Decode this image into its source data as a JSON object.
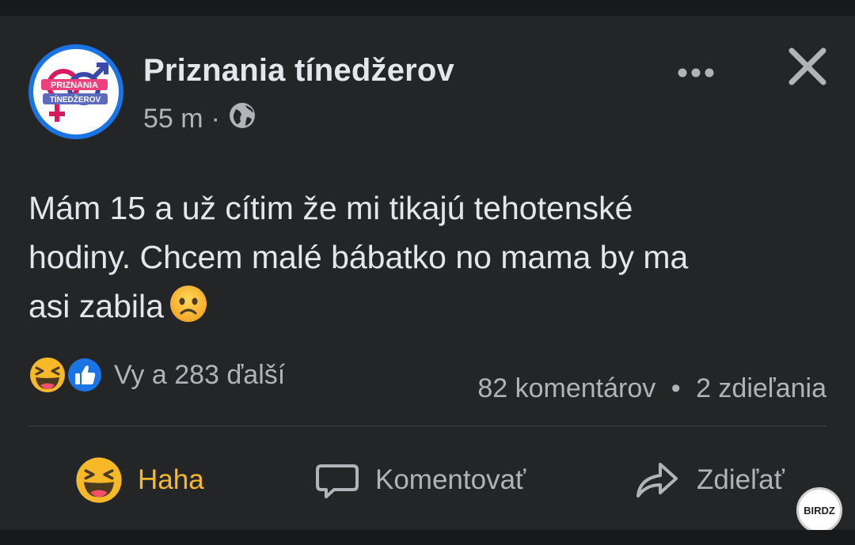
{
  "post": {
    "page_name": "Priznania tínedžerov",
    "time": "55 m",
    "separator": "·",
    "privacy_icon": "globe-icon",
    "avatar_text_top": "PRIZNANIA",
    "avatar_text_bottom": "TÍNEDŽEROV",
    "body_line1": "Mám 15 a už cítim že mi tikajú tehotenské",
    "body_line2": "hodiny. Chcem malé bábatko no mama by ma",
    "body_line3": "asi zabila",
    "body_emoji": "sad-face-icon"
  },
  "reactions": {
    "icons": [
      "haha-reaction-icon",
      "like-reaction-icon"
    ],
    "summary": "Vy a 283 ďalší"
  },
  "stats": {
    "comments": "82 komentárov",
    "dot": "•",
    "shares": "2 zdieľania"
  },
  "actions": {
    "haha_label": "Haha",
    "comment_label": "Komentovať",
    "share_label": "Zdieľať"
  },
  "watermark": {
    "text": "BIRDZ"
  },
  "colors": {
    "background": "#242526",
    "text": "#e4e6eb",
    "secondary": "#b0b3b8",
    "haha": "#f7b928",
    "like": "#1b74e4"
  }
}
